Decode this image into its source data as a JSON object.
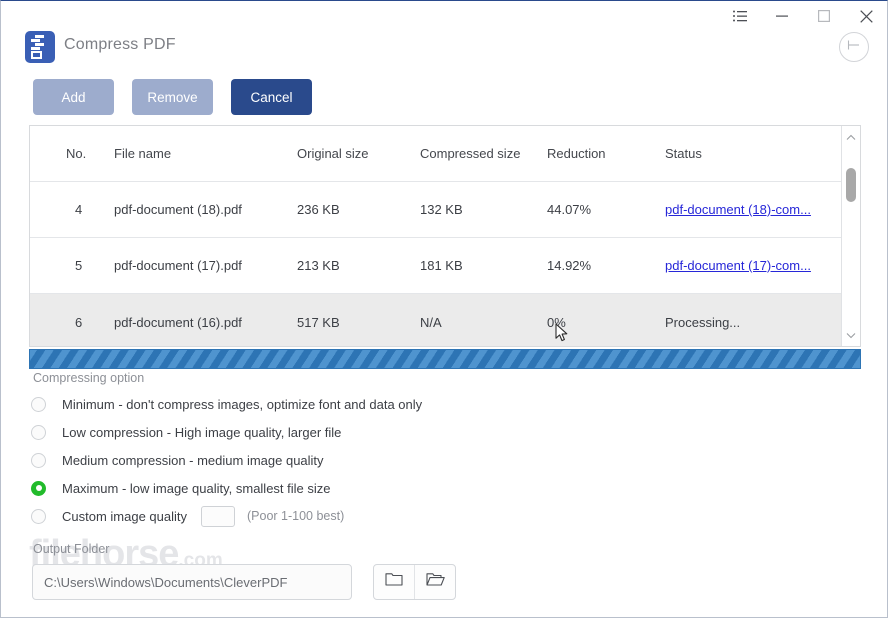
{
  "window": {
    "titlebar_buttons": [
      {
        "name": "menu-icon",
        "label": "☰"
      },
      {
        "name": "minimize-icon",
        "label": "─"
      },
      {
        "name": "maximize-icon",
        "label": "□"
      },
      {
        "name": "close-icon",
        "label": "✕"
      }
    ]
  },
  "header": {
    "app_icon": "zip-file-icon",
    "title": "Compress PDF",
    "back_button": "back-arrow-icon"
  },
  "toolbar": {
    "add_label": "Add",
    "remove_label": "Remove",
    "cancel_label": "Cancel"
  },
  "table": {
    "columns": [
      "No.",
      "File name",
      "Original size",
      "Compressed size",
      "Reduction",
      "Status"
    ],
    "rows": [
      {
        "no": "4",
        "file_name": "pdf-document (18).pdf",
        "original_size": "236 KB",
        "compressed_size": "132 KB",
        "reduction": "44.07%",
        "status": "pdf-document (18)-com...",
        "status_is_link": true,
        "selected": false
      },
      {
        "no": "5",
        "file_name": "pdf-document (17).pdf",
        "original_size": "213 KB",
        "compressed_size": "181 KB",
        "reduction": "14.92%",
        "status": "pdf-document (17)-com...",
        "status_is_link": true,
        "selected": false
      },
      {
        "no": "6",
        "file_name": "pdf-document (16).pdf",
        "original_size": "517 KB",
        "compressed_size": "N/A",
        "reduction": "0%",
        "status": "Processing...",
        "status_is_link": false,
        "selected": true
      }
    ]
  },
  "progress": {
    "indeterminate": true,
    "stripe_dark": "#2d74b4",
    "stripe_light": "#4f94cf"
  },
  "options": {
    "label": "Compressing option",
    "selected_index": 3,
    "items": [
      {
        "label": "Minimum - don't compress images, optimize font and data only"
      },
      {
        "label": "Low compression - High image quality, larger file"
      },
      {
        "label": "Medium compression - medium image quality"
      },
      {
        "label": "Maximum - low image quality, smallest file size"
      },
      {
        "label": "Custom image quality"
      }
    ],
    "custom_quality_value": "",
    "custom_quality_placeholder": "",
    "custom_quality_hint": "(Poor 1-100 best)",
    "selected_color": "#22bb2b"
  },
  "output": {
    "label": "Output Folder",
    "path": "C:\\Users\\Windows\\Documents\\CleverPDF",
    "browse_button": "folder-closed-icon",
    "open_button": "folder-open-icon"
  },
  "watermark": {
    "text": "filehorse",
    "suffix": ".com"
  }
}
